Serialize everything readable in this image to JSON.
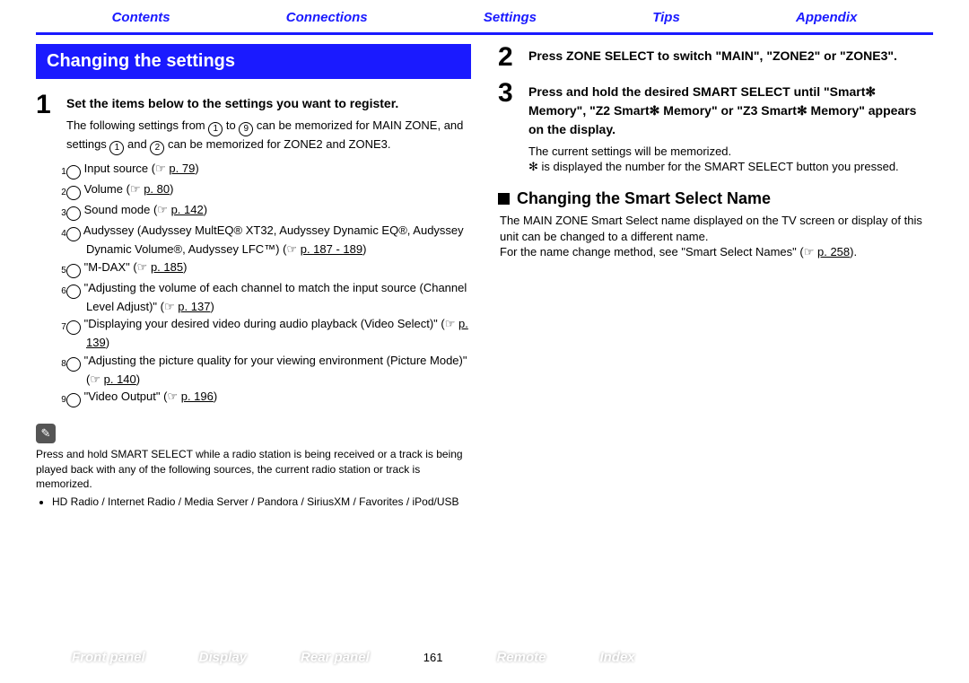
{
  "topnav": {
    "contents": "Contents",
    "connections": "Connections",
    "settings": "Settings",
    "tips": "Tips",
    "appendix": "Appendix"
  },
  "title": "Changing the settings",
  "step1": {
    "num": "1",
    "head": "Set the items below to the settings you want to register.",
    "intro_a": "The following settings from ",
    "c1": "1",
    "intro_b": " to ",
    "c9": "9",
    "intro_c": " can be memorized for MAIN ZONE, and settings ",
    "c1b": "1",
    "intro_d": " and ",
    "c2": "2",
    "intro_e": " can be memorized for ZONE2 and ZONE3.",
    "items": [
      {
        "n": "1",
        "pre": "Input source  (",
        "link": "p. 79",
        "post": ")"
      },
      {
        "n": "2",
        "pre": "Volume  (",
        "link": "p. 80",
        "post": ")"
      },
      {
        "n": "3",
        "pre": "Sound mode  (",
        "link": "p. 142",
        "post": ")"
      },
      {
        "n": "4",
        "pre": "Audyssey (Audyssey MultEQ® XT32, Audyssey Dynamic EQ®, Audyssey Dynamic Volume®, Audyssey LFC™)  (",
        "link": "p. 187 - 189",
        "post": ")"
      },
      {
        "n": "5",
        "pre": "\"M-DAX\" (",
        "link": "p. 185",
        "post": ")"
      },
      {
        "n": "6",
        "pre": "\"Adjusting the volume of each channel to match the input source (Channel Level Adjust)\" (",
        "link": "p. 137",
        "post": ")"
      },
      {
        "n": "7",
        "pre": "\"Displaying your desired video during audio playback (Video Select)\" (",
        "link": "p. 139",
        "post": ")"
      },
      {
        "n": "8",
        "pre": "\"Adjusting the picture quality for your viewing environment (Picture Mode)\" (",
        "link": "p. 140",
        "post": ")"
      },
      {
        "n": "9",
        "pre": "\"Video Output\"  (",
        "link": "p. 196",
        "post": ")"
      }
    ]
  },
  "note": {
    "icon": "✎",
    "text": "Press and hold SMART SELECT while a radio station is being received or a track is being played back with any of the following sources, the current radio station or track is memorized.",
    "bullet": "HD Radio / Internet Radio / Media Server / Pandora / SiriusXM / Favorites / iPod/USB"
  },
  "step2": {
    "num": "2",
    "head": "Press ZONE SELECT to switch \"MAIN\", \"ZONE2\" or \"ZONE3\"."
  },
  "step3": {
    "num": "3",
    "head_a": "Press and hold the desired SMART SELECT until \"Smart",
    "head_b": " Memory\", \"Z2 Smart",
    "head_c": " Memory\" or \"Z3 Smart",
    "head_d": " Memory\" appears on the display.",
    "line1": "The current settings will be memorized.",
    "line2_a": "✻ is displayed the number for the SMART SELECT button you pressed."
  },
  "subhead": "Changing the Smart Select Name",
  "sub_body": {
    "p1": "The MAIN ZONE Smart Select name displayed on the TV screen or display of this unit can be changed to a different name.",
    "p2_a": "For the name change method, see \"Smart Select Names\" (",
    "p2_link": "p. 258",
    "p2_b": ")."
  },
  "bottom": {
    "front": "Front panel",
    "display": "Display",
    "rear": "Rear panel",
    "pagenum": "161",
    "remote": "Remote",
    "index": "Index"
  },
  "glyph": {
    "hand": "☞",
    "star": "✻"
  }
}
